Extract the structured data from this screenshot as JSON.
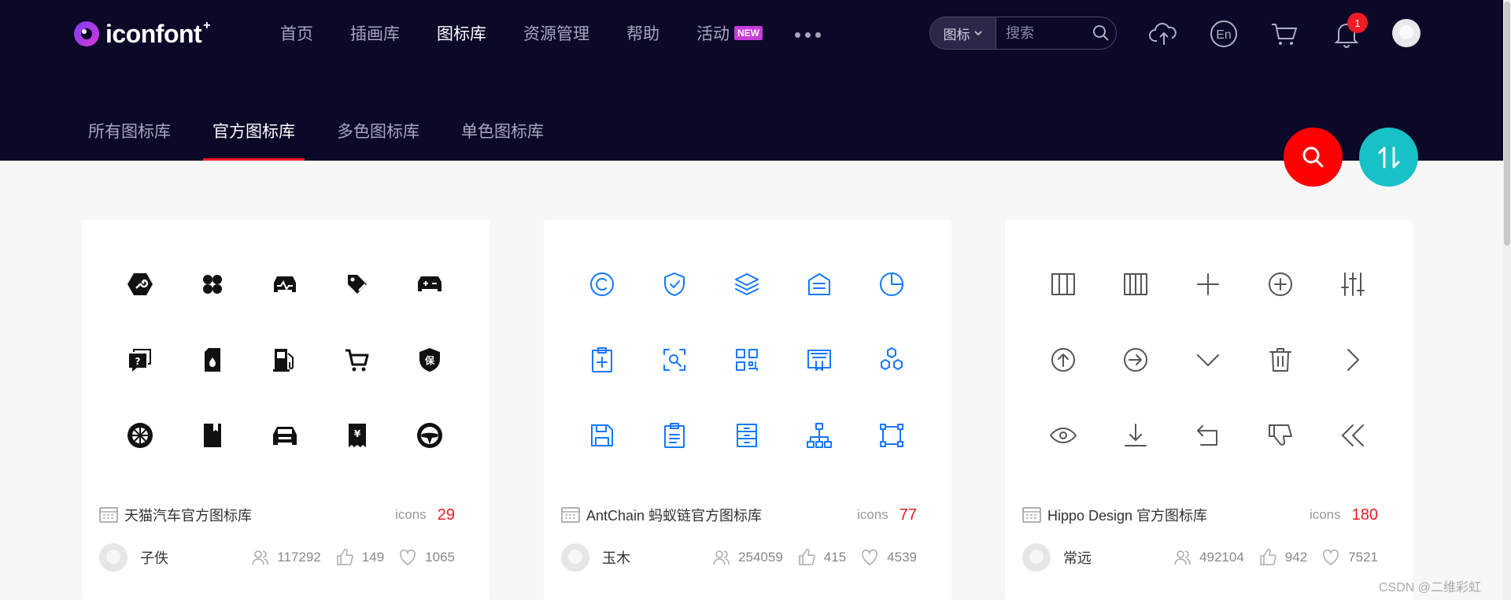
{
  "brand": {
    "name": "iconfont",
    "plus": "+"
  },
  "nav": [
    {
      "label": "首页",
      "active": false
    },
    {
      "label": "插画库",
      "active": false
    },
    {
      "label": "图标库",
      "active": true
    },
    {
      "label": "资源管理",
      "active": false
    },
    {
      "label": "帮助",
      "active": false
    },
    {
      "label": "活动",
      "active": false,
      "badge": "NEW"
    }
  ],
  "search": {
    "type_label": "图标",
    "placeholder": "搜索"
  },
  "header_icons": [
    "upload-cloud-icon",
    "language-en-icon",
    "cart-icon",
    "bell-icon"
  ],
  "lang_label": "En",
  "notifications": {
    "count": "1"
  },
  "subnav": [
    {
      "label": "所有图标库",
      "active": false
    },
    {
      "label": "官方图标库",
      "active": true
    },
    {
      "label": "多色图标库",
      "active": false
    },
    {
      "label": "单色图标库",
      "active": false
    }
  ],
  "colors": {
    "header_bg": "#0b0828",
    "accent_red": "#ee1c25",
    "fab_search": "#ff0000",
    "fab_sort": "#17c1c6",
    "icon_blue": "#1677ff",
    "icon_gray": "#555555",
    "icon_black": "#111111"
  },
  "cards": [
    {
      "title": "天猫汽车官方图标库",
      "icons_label": "icons",
      "icons_count": "29",
      "author": "子佚",
      "views": "117292",
      "likes": "149",
      "favorites": "1065",
      "icon_color": "black",
      "icons": [
        "wrench-hex-icon",
        "four-petal-icon",
        "car-front-pulse-icon",
        "tag-edit-icon",
        "car-plus-minus-icon",
        "chat-question-icon",
        "oil-can-icon",
        "fuel-pump-icon",
        "shopping-cart-icon",
        "shield-insurance-icon",
        "wheel-icon",
        "manual-book-icon",
        "car-front-icon",
        "receipt-yen-icon",
        "steering-wheel-icon"
      ]
    },
    {
      "title": "AntChain 蚂蚁链官方图标库",
      "icons_label": "icons",
      "icons_count": "77",
      "author": "玉木",
      "views": "254059",
      "likes": "415",
      "favorites": "4539",
      "icon_color": "blue",
      "icons": [
        "copyright-icon",
        "shield-check-icon",
        "layers-icon",
        "bank-icon",
        "pie-chart-icon",
        "clipboard-add-icon",
        "scan-search-icon",
        "qrcode-icon",
        "certificate-icon",
        "hexagons-icon",
        "save-icon",
        "clipboard-list-icon",
        "archive-drawers-icon",
        "hierarchy-icon",
        "node-graph-icon"
      ]
    },
    {
      "title": "Hippo Design 官方图标库",
      "icons_label": "icons",
      "icons_count": "180",
      "author": "常远",
      "views": "492104",
      "likes": "942",
      "favorites": "7521",
      "icon_color": "gray",
      "icons": [
        "columns-three-icon",
        "columns-four-icon",
        "plus-icon",
        "plus-circle-icon",
        "sliders-icon",
        "arrow-up-circle-icon",
        "arrow-right-circle-icon",
        "chevron-down-icon",
        "trash-icon",
        "chevron-right-icon",
        "eye-icon",
        "download-icon",
        "undo-icon",
        "thumbs-down-icon",
        "chevrons-left-icon"
      ]
    }
  ],
  "watermark": "CSDN @二维彩虹"
}
